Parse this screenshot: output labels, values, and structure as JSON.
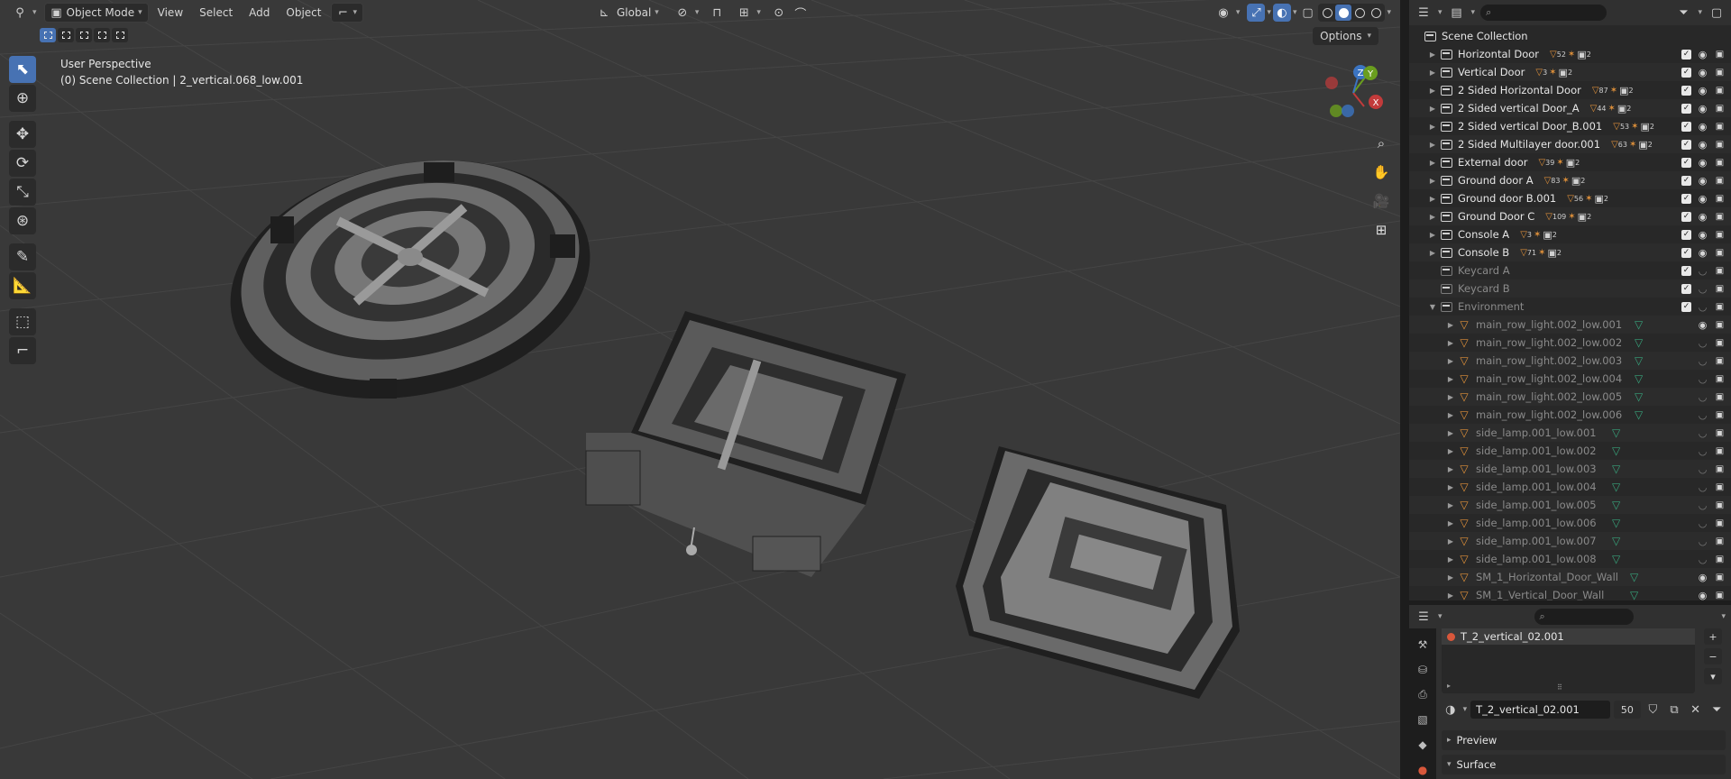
{
  "viewport": {
    "header": {
      "mode": "Object Mode",
      "menus": [
        "View",
        "Select",
        "Add",
        "Object"
      ],
      "orientation": "Global"
    },
    "info_line1": "User Perspective",
    "info_line2": "(0) Scene Collection | 2_vertical.068_low.001",
    "options_label": "Options",
    "gizmo": {
      "x_label": "X",
      "y_label": "Y",
      "z_label": "Z"
    }
  },
  "outliner": {
    "root_label": "Scene Collection",
    "items": [
      {
        "label": "Horizontal Door",
        "count": "52",
        "count2": "2"
      },
      {
        "label": "Vertical Door",
        "count": "3",
        "count2": "2"
      },
      {
        "label": "2 Sided Horizontal Door",
        "count": "87",
        "count2": "2"
      },
      {
        "label": "2 Sided vertical Door_A",
        "count": "44",
        "count2": "2"
      },
      {
        "label": "2 Sided vertical Door_B.001",
        "count": "53",
        "count2": "2"
      },
      {
        "label": "2 Sided Multilayer door.001",
        "count": "63",
        "count2": "2"
      },
      {
        "label": "External door",
        "count": "39",
        "count2": "2"
      },
      {
        "label": "Ground door A",
        "count": "83",
        "count2": "2"
      },
      {
        "label": "Ground door B.001",
        "count": "56",
        "count2": "2"
      },
      {
        "label": "Ground Door C",
        "count": "109",
        "count2": "2"
      },
      {
        "label": "Console A",
        "count": "3",
        "count2": "2"
      },
      {
        "label": "Console B",
        "count": "71",
        "count2": "2"
      }
    ],
    "excluded": [
      {
        "label": "Keycard A"
      },
      {
        "label": "Keycard B"
      },
      {
        "label": "Environment"
      }
    ],
    "env_children": [
      {
        "label": "main_row_light.002_low.001"
      },
      {
        "label": "main_row_light.002_low.002"
      },
      {
        "label": "main_row_light.002_low.003"
      },
      {
        "label": "main_row_light.002_low.004"
      },
      {
        "label": "main_row_light.002_low.005"
      },
      {
        "label": "main_row_light.002_low.006"
      },
      {
        "label": "side_lamp.001_low.001"
      },
      {
        "label": "side_lamp.001_low.002"
      },
      {
        "label": "side_lamp.001_low.003"
      },
      {
        "label": "side_lamp.001_low.004"
      },
      {
        "label": "side_lamp.001_low.005"
      },
      {
        "label": "side_lamp.001_low.006"
      },
      {
        "label": "side_lamp.001_low.007"
      },
      {
        "label": "side_lamp.001_low.008"
      },
      {
        "label": "SM_1_Horizontal_Door_Wall"
      },
      {
        "label": "SM_1_Vertical_Door_Wall"
      }
    ]
  },
  "properties": {
    "slot_name": "T_2_vertical_02.001",
    "material_name": "T_2_vertical_02.001",
    "users": "50",
    "panels": {
      "preview": "Preview",
      "surface": "Surface"
    }
  }
}
